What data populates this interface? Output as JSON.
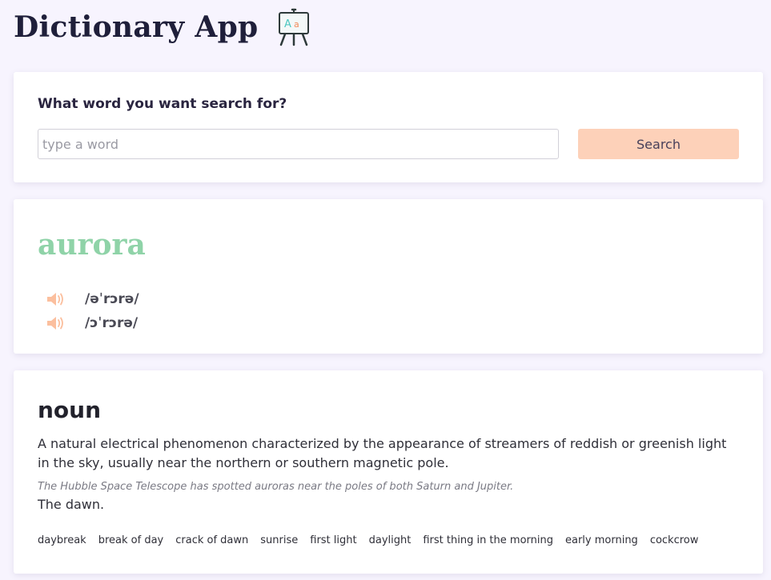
{
  "app": {
    "title": "Dictionary App"
  },
  "search": {
    "prompt": "What word you want search for?",
    "placeholder": "type a word",
    "value": "",
    "button_label": "Search"
  },
  "result": {
    "word": "aurora",
    "phonetics": [
      {
        "text": "/əˈrɔrə/",
        "icon": "speaker-icon"
      },
      {
        "text": "/ɔˈrɔrə/",
        "icon": "speaker-icon"
      }
    ],
    "meanings": [
      {
        "part_of_speech": "noun",
        "definitions": [
          {
            "definition": "A natural electrical phenomenon characterized by the appearance of streamers of reddish or greenish light in the sky, usually near the northern or southern magnetic pole.",
            "example": "The Hubble Space Telescope has spotted auroras near the poles of both Saturn and Jupiter."
          },
          {
            "definition": "The dawn."
          }
        ],
        "synonyms": [
          "daybreak",
          "break of day",
          "crack of dawn",
          "sunrise",
          "first light",
          "daylight",
          "first thing in the morning",
          "early morning",
          "cockcrow"
        ]
      }
    ]
  },
  "colors": {
    "background": "#f7f4fe",
    "accent_button": "#fdd1b9",
    "headword": "#8fd3a8",
    "speaker": "#fbbf9e"
  }
}
